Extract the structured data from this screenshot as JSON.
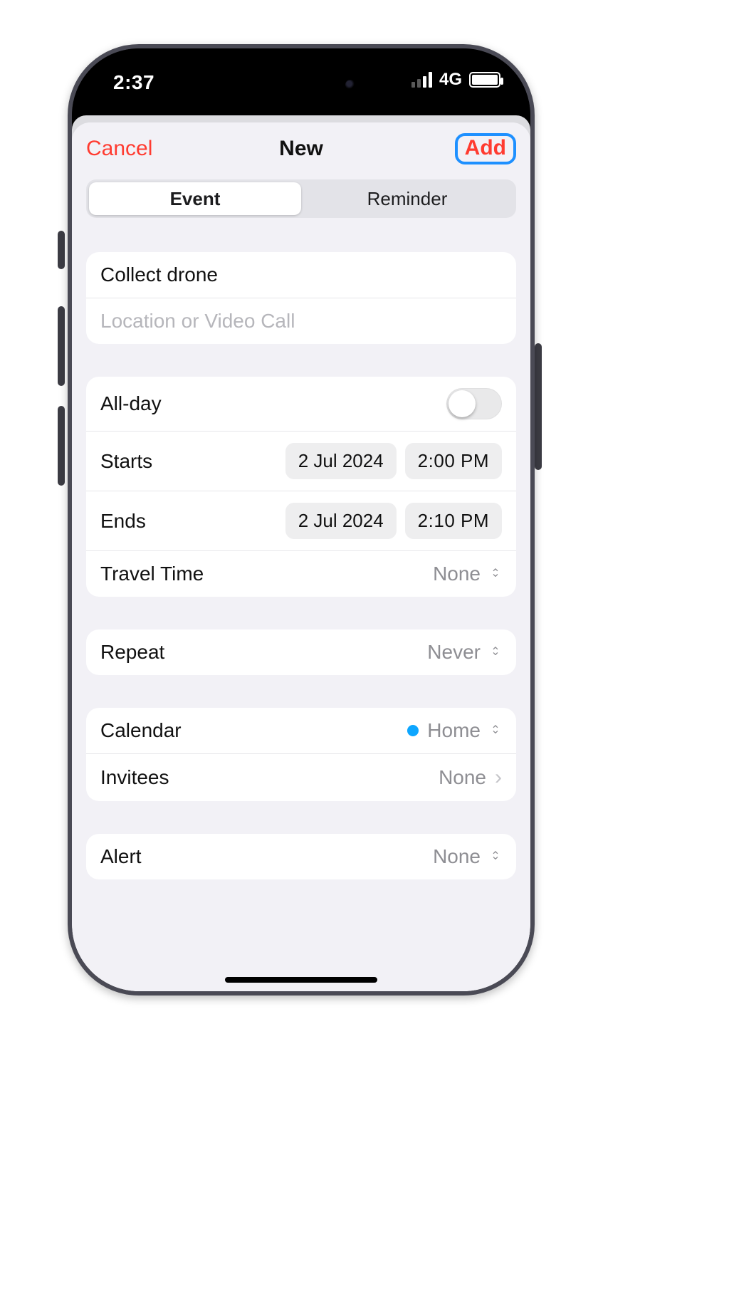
{
  "status": {
    "time": "2:37",
    "network": "4G"
  },
  "nav": {
    "cancel": "Cancel",
    "title": "New",
    "add": "Add"
  },
  "segmented": {
    "event": "Event",
    "reminder": "Reminder",
    "active": "event"
  },
  "title_field": {
    "value": "Collect drone"
  },
  "location_field": {
    "placeholder": "Location or Video Call"
  },
  "allday": {
    "label": "All-day",
    "on": false
  },
  "starts": {
    "label": "Starts",
    "date": "2 Jul 2024",
    "time": "2:00 PM"
  },
  "ends": {
    "label": "Ends",
    "date": "2 Jul 2024",
    "time": "2:10 PM"
  },
  "travel": {
    "label": "Travel Time",
    "value": "None"
  },
  "repeat": {
    "label": "Repeat",
    "value": "Never"
  },
  "calendar": {
    "label": "Calendar",
    "value": "Home",
    "color": "#0da6ff"
  },
  "invitees": {
    "label": "Invitees",
    "value": "None"
  },
  "alert": {
    "label": "Alert",
    "value": "None"
  }
}
